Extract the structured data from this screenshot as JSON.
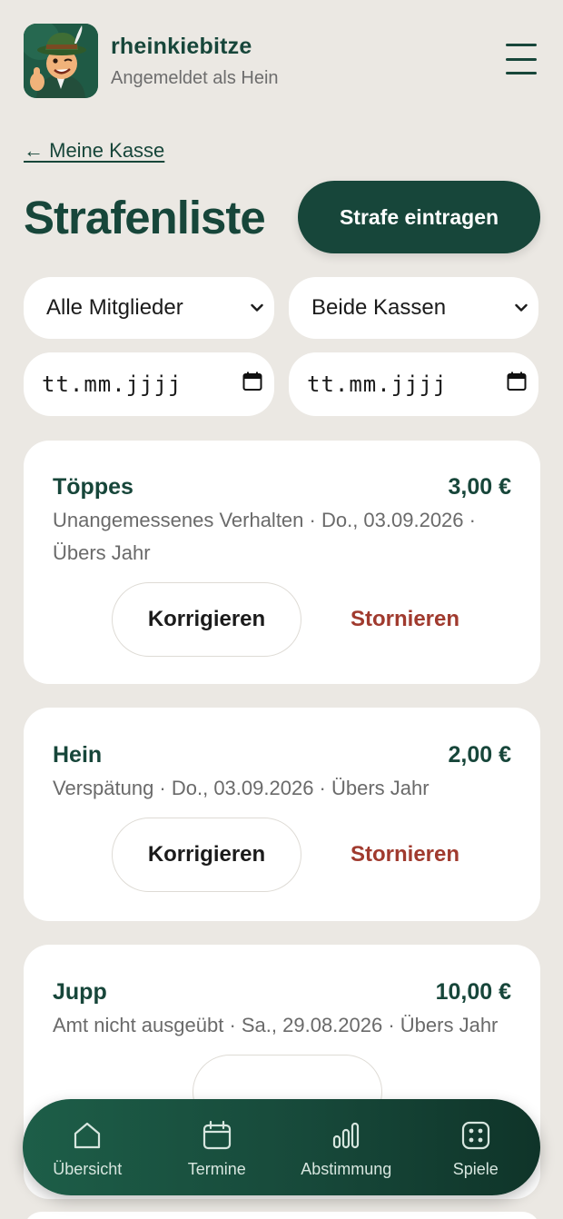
{
  "header": {
    "app_name": "rheinkiebitze",
    "subtitle": "Angemeldet als Hein"
  },
  "nav_back": "← Meine Kasse",
  "page": {
    "title": "Strafenliste",
    "primary_action": "Strafe eintragen"
  },
  "filters": {
    "member": "Alle Mitglieder",
    "kasse": "Beide Kassen",
    "date_from": "tt.mm.jjjj",
    "date_to": "tt.mm.jjjj"
  },
  "penalties": [
    {
      "name": "Töppes",
      "amount": "3,00 €",
      "detail": "Unangemessenes Verhalten · Do., 03.09.2026 · Übers Jahr",
      "correct": "Korrigieren",
      "cancel": "Stornieren"
    },
    {
      "name": "Hein",
      "amount": "2,00 €",
      "detail": "Verspätung · Do., 03.09.2026 · Übers Jahr",
      "correct": "Korrigieren",
      "cancel": "Stornieren"
    },
    {
      "name": "Jupp",
      "amount": "10,00 €",
      "detail": "Amt nicht ausgeübt · Sa., 29.08.2026 · Übers Jahr"
    }
  ],
  "bottom_nav": [
    {
      "label": "Übersicht",
      "icon": "home-icon"
    },
    {
      "label": "Termine",
      "icon": "calendar-icon"
    },
    {
      "label": "Abstimmung",
      "icon": "bar-chart-icon"
    },
    {
      "label": "Spiele",
      "icon": "dice-icon"
    }
  ],
  "colors": {
    "primary": "#17463a",
    "danger": "#a03a2e",
    "background": "#ebe8e3"
  }
}
